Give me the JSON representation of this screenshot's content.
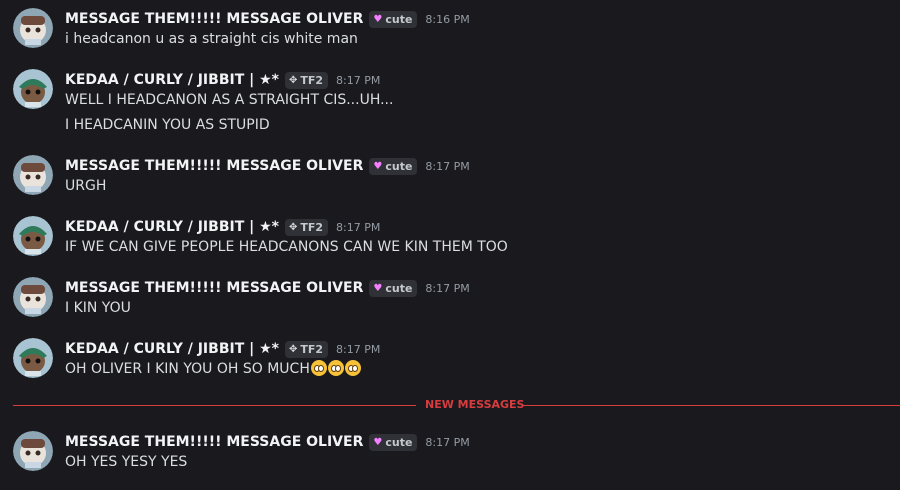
{
  "divider": {
    "label": "NEW MESSAGES"
  },
  "messages": [
    {
      "author": "MESSAGE THEM!!!!! MESSAGE OLIVER",
      "tag": "cute",
      "tag_icon": "heart-icon",
      "time": "8:16 PM",
      "lines": [
        "i headcanon u as a straight cis white man"
      ]
    },
    {
      "author": "KEDAA / CURLY / JIBBIT | ★*",
      "tag": "TF2",
      "tag_icon": "tf2-icon",
      "time": "8:17 PM",
      "lines": [
        "WELL I HEADCANON AS A STRAIGHT CIS...UH...",
        "I HEADCANIN YOU AS STUPID"
      ]
    },
    {
      "author": "MESSAGE THEM!!!!! MESSAGE OLIVER",
      "tag": "cute",
      "tag_icon": "heart-icon",
      "time": "8:17 PM",
      "lines": [
        "URGH"
      ]
    },
    {
      "author": "KEDAA / CURLY / JIBBIT | ★*",
      "tag": "TF2",
      "tag_icon": "tf2-icon",
      "time": "8:17 PM",
      "lines": [
        "IF WE CAN GIVE PEOPLE HEADCANONS CAN WE KIN THEM TOO"
      ]
    },
    {
      "author": "MESSAGE THEM!!!!! MESSAGE OLIVER",
      "tag": "cute",
      "tag_icon": "heart-icon",
      "time": "8:17 PM",
      "lines": [
        "I KIN YOU"
      ]
    },
    {
      "author": "KEDAA / CURLY / JIBBIT | ★*",
      "tag": "TF2",
      "tag_icon": "tf2-icon",
      "time": "8:17 PM",
      "lines": [
        "OH OLIVER I KIN YOU OH SO MUCH"
      ],
      "emojis": [
        "pleading-face-icon",
        "pleading-face-icon",
        "pleading-face-icon"
      ]
    },
    {
      "author": "MESSAGE THEM!!!!! MESSAGE OLIVER",
      "tag": "cute",
      "tag_icon": "heart-icon",
      "time": "8:17 PM",
      "lines": [
        "OH YES YESY YES"
      ]
    }
  ],
  "colors": {
    "background": "#1a1a1e",
    "author": "#f2f3f5",
    "text": "#dbdee1",
    "timestamp": "#949ba4",
    "new_messages": "#d83c3e"
  }
}
